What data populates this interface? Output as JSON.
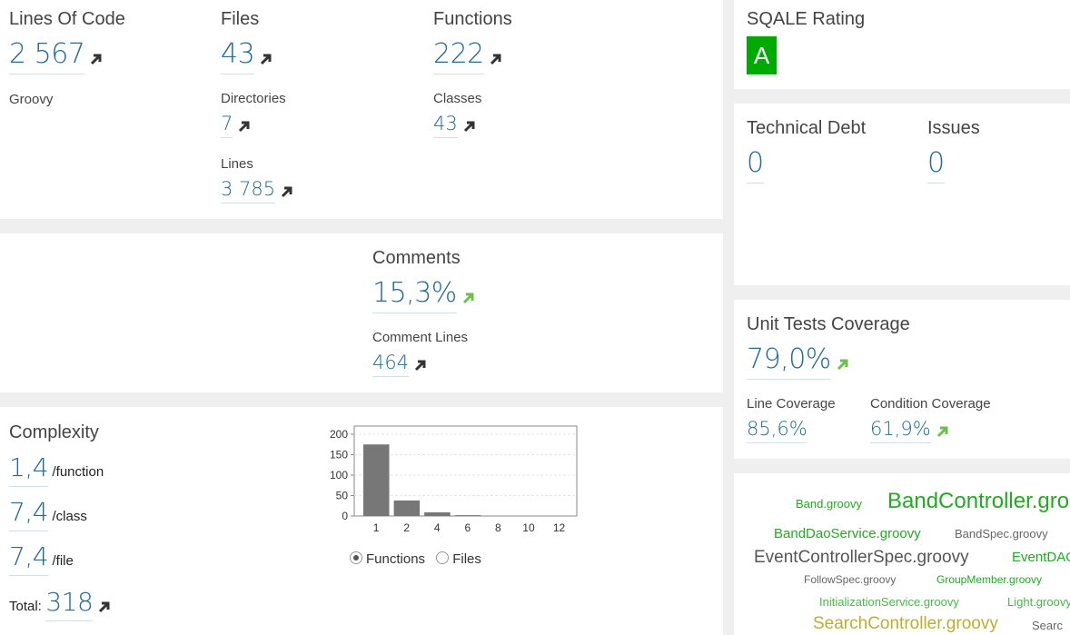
{
  "size": {
    "lines_label": "Lines Of Code",
    "lines_value": "2 567",
    "language": "Groovy",
    "files_label": "Files",
    "files_value": "43",
    "directories_label": "Directories",
    "directories_value": "7",
    "lines_total_label": "Lines",
    "lines_total_value": "3 785",
    "functions_label": "Functions",
    "functions_value": "222",
    "classes_label": "Classes",
    "classes_value": "43"
  },
  "comments": {
    "label": "Comments",
    "value": "15,3%",
    "comment_lines_label": "Comment Lines",
    "comment_lines_value": "464"
  },
  "complexity": {
    "label": "Complexity",
    "per_function_value": "1,4",
    "per_function_unit": "/function",
    "per_class_value": "7,4",
    "per_class_unit": "/class",
    "per_file_value": "7,4",
    "per_file_unit": "/file",
    "total_label": "Total:",
    "total_value": "318",
    "radio_functions": "Functions",
    "radio_files": "Files"
  },
  "chart_data": {
    "type": "bar",
    "categories": [
      "1",
      "2",
      "4",
      "6",
      "8",
      "10",
      "12"
    ],
    "values": [
      175,
      38,
      9,
      2,
      0,
      0,
      0
    ],
    "ylim": [
      0,
      220
    ],
    "yticks": [
      "0",
      "50",
      "100",
      "150",
      "200"
    ],
    "ytick_values": [
      0,
      50,
      100,
      150,
      200
    ],
    "grid": true,
    "bar_color": "#777777"
  },
  "sqale": {
    "label": "SQALE Rating",
    "value": "A",
    "color": "#00aa00"
  },
  "debt": {
    "technical_debt_label": "Technical Debt",
    "technical_debt_value": "0",
    "issues_label": "Issues",
    "issues_value": "0"
  },
  "tests": {
    "label": "Unit Tests Coverage",
    "value": "79,0%",
    "line_label": "Line Coverage",
    "line_value": "85,6%",
    "condition_label": "Condition Coverage",
    "condition_value": "61,9%"
  },
  "cloud": [
    {
      "name": "Band.groovy",
      "color": "#22aa22"
    },
    {
      "name": "BandController.groovy",
      "color": "#22aa22"
    },
    {
      "name": "BandDaoService.groovy",
      "color": "#22aa22"
    },
    {
      "name": "BandSpec.groovy",
      "color": "#666666"
    },
    {
      "name": "EventControllerSpec.groovy",
      "color": "#555555"
    },
    {
      "name": "EventDAO",
      "color": "#22aa22"
    },
    {
      "name": "FollowSpec.groovy",
      "color": "#666666"
    },
    {
      "name": "GroupMember.groovy",
      "color": "#22aa22"
    },
    {
      "name": "InitializationService.groovy",
      "color": "#44bb44"
    },
    {
      "name": "Light.groovy",
      "color": "#44bb44"
    },
    {
      "name": "SearchController.groovy",
      "color": "#b8b030"
    },
    {
      "name": "Searc",
      "color": "#666666"
    }
  ],
  "colors": {
    "value_blue": "#236a97",
    "arrow_dark": "#333333",
    "arrow_green": "#6cc04a"
  }
}
